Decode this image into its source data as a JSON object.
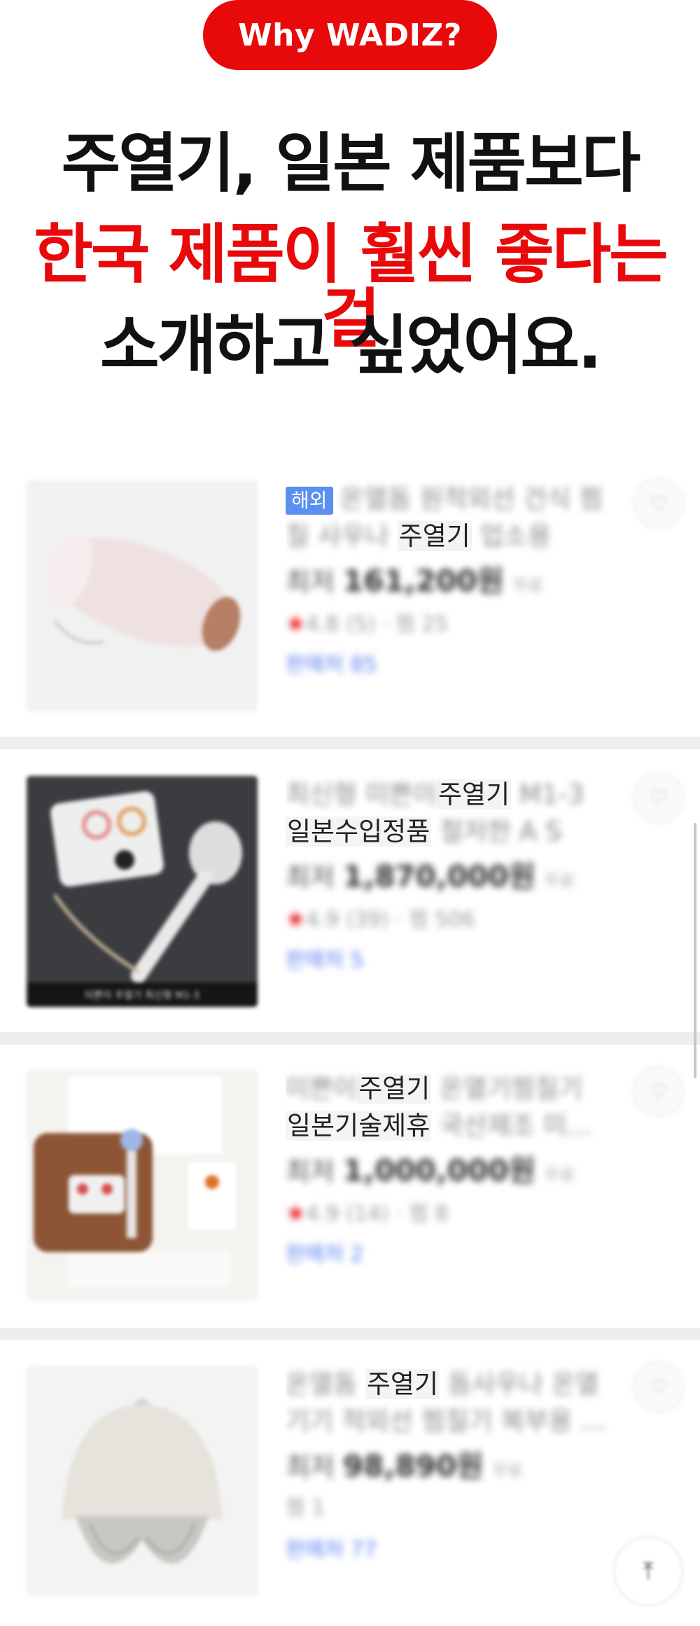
{
  "header": {
    "badge": "Why WADIZ?",
    "line1": "주열기, 일본 제품보다",
    "line2": "한국 제품이 훨씬 좋다는 걸",
    "line3": "소개하고 싶었어요."
  },
  "colors": {
    "accent": "#e8090b",
    "overseas_badge": "#5b8ff0",
    "seller": "#5a7ff0"
  },
  "products": [
    {
      "badge": "해외",
      "title_a_blur": "온열돔 원적외선 건식 찜",
      "title_b_blur": "질 사우나 ",
      "title_b_clear": "주열기",
      "title_b_blur2": " 업소용",
      "price_prefix": "최저",
      "price": "161,200원",
      "shipping": "무료",
      "rating": "4.8",
      "review": "(5) · 찜 25",
      "seller": "판매처 85"
    },
    {
      "title_a_blur": "최신형 미쁜이",
      "title_a_clear": "주열기",
      "title_a_blur2": " M1-3",
      "title_b_clear": "일본수입정품",
      "title_b_blur": " 철저한 A S",
      "price_prefix": "최저",
      "price": "1,870,000원",
      "shipping": "무료",
      "rating": "4.9",
      "review": "(39) · 찜 506",
      "seller": "판매처 5",
      "thumb_caption": "미쁜이 주열기 최신형 M1-3"
    },
    {
      "title_a_blur": "미쁜이",
      "title_a_clear": "주열기",
      "title_a_blur2": " 온열기찜질기",
      "title_b_clear": "일본기술제휴",
      "title_b_blur": " 국산제조 미...",
      "price_prefix": "최저",
      "price": "1,000,000원",
      "shipping": "무료",
      "rating": "4.9",
      "review": "(14) · 찜 8",
      "seller": "판매처 2"
    },
    {
      "title_a_blur": "온열돔 ",
      "title_a_clear": "주열기",
      "title_a_blur2": " 돔사우나 온열",
      "title_b_blur": "기기 적외선 찜질기 복부용 ...",
      "price_prefix": "최저",
      "price": "98,890원",
      "shipping": "무료",
      "review": "찜 1",
      "seller": "판매처 77"
    }
  ],
  "icons": {
    "heart": "heart-icon",
    "top": "scroll-top-icon"
  }
}
